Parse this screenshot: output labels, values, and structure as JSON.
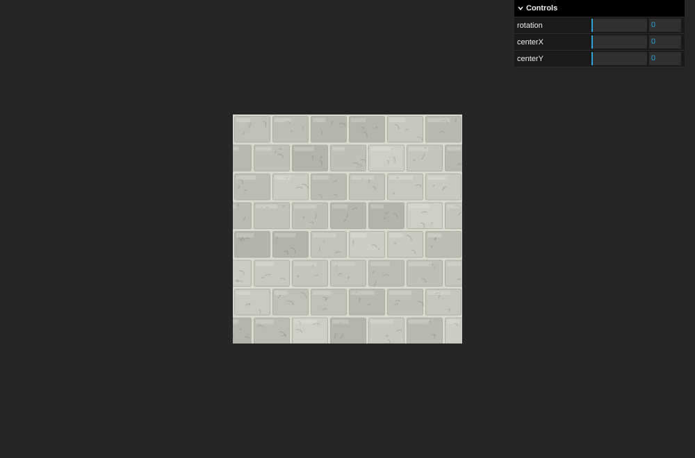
{
  "gui": {
    "title": "Controls",
    "controls": [
      {
        "name": "rotation",
        "value": "0",
        "fraction": 0
      },
      {
        "name": "centerX",
        "value": "0",
        "fraction": 0
      },
      {
        "name": "centerY",
        "value": "0",
        "fraction": 0
      }
    ],
    "accent_color": "#2fa1d6"
  },
  "canvas": {
    "background_color": "#262626",
    "texture": "stone-wall"
  }
}
